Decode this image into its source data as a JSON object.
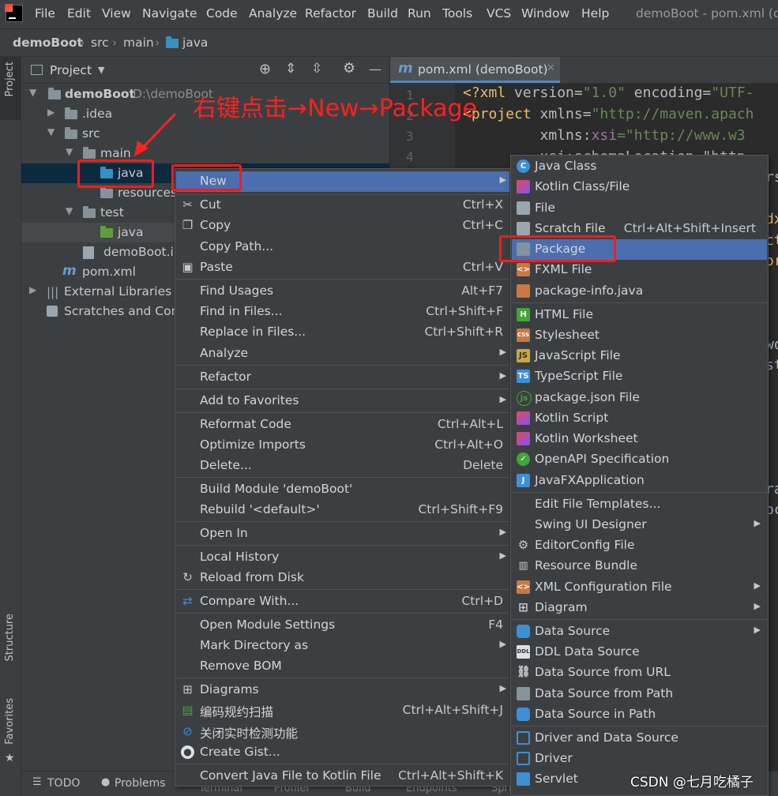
{
  "menubar": {
    "items": [
      "File",
      "Edit",
      "View",
      "Navigate",
      "Code",
      "Analyze",
      "Refactor",
      "Build",
      "Run",
      "Tools",
      "VCS",
      "Window",
      "Help"
    ],
    "window_title": "demoBoot - pom.xml (de"
  },
  "breadcrumb": [
    "demoBoot",
    "src",
    "main",
    "java"
  ],
  "stripe": {
    "project": "Project",
    "structure": "Structure",
    "favorites": "Favorites"
  },
  "project_panel": {
    "title": "Project",
    "tree": [
      {
        "label": "demoBoot",
        "path": "D:\\demoBoot"
      },
      {
        "label": ".idea"
      },
      {
        "label": "src"
      },
      {
        "label": "main"
      },
      {
        "label": "java"
      },
      {
        "label": "resources"
      },
      {
        "label": "test"
      },
      {
        "label": "java"
      },
      {
        "label": "demoBoot.iml"
      },
      {
        "label": "pom.xml"
      },
      {
        "label": "External Libraries"
      },
      {
        "label": "Scratches and Cons"
      }
    ]
  },
  "editor": {
    "tab": "pom.xml (demoBoot)",
    "gutter": [
      "1",
      "2",
      "3",
      "4"
    ],
    "lines": [
      {
        "a": "<?xml ",
        "b": "version=",
        "c": "\"1.0\" ",
        "d": "encoding=",
        "e": "\"UTF-"
      },
      {
        "a": "<project ",
        "b": "xmlns=",
        "c": "\"http://maven.apach"
      },
      {
        "a": "         ",
        "b": "xmlns:",
        "c": "xsi",
        "d": "=\"http://www.w3"
      },
      {
        "a": "         ",
        "b": "xsi:schemaLocation=\"http"
      }
    ],
    "peeks": [
      "rs",
      "dx",
      "ct",
      "or",
      "wo",
      "st",
      "ra",
      "oc"
    ]
  },
  "annotation": "右键点击→New→Package",
  "context_menu": {
    "items": [
      {
        "label": "New",
        "shortcut": "",
        "submenu": true,
        "selected": true
      },
      {
        "label": "Cut",
        "shortcut": "Ctrl+X",
        "icon": "scissors"
      },
      {
        "label": "Copy",
        "shortcut": "Ctrl+C",
        "icon": "copy"
      },
      {
        "label": "Copy Path...",
        "shortcut": ""
      },
      {
        "label": "Paste",
        "shortcut": "Ctrl+V",
        "icon": "clipboard"
      },
      {
        "label": "Find Usages",
        "shortcut": "Alt+F7"
      },
      {
        "label": "Find in Files...",
        "shortcut": "Ctrl+Shift+F"
      },
      {
        "label": "Replace in Files...",
        "shortcut": "Ctrl+Shift+R"
      },
      {
        "label": "Analyze",
        "shortcut": "",
        "submenu": true
      },
      {
        "label": "Refactor",
        "shortcut": "",
        "submenu": true
      },
      {
        "label": "Add to Favorites",
        "shortcut": "",
        "submenu": true
      },
      {
        "label": "Reformat Code",
        "shortcut": "Ctrl+Alt+L"
      },
      {
        "label": "Optimize Imports",
        "shortcut": "Ctrl+Alt+O"
      },
      {
        "label": "Delete...",
        "shortcut": "Delete"
      },
      {
        "label": "Build Module 'demoBoot'",
        "shortcut": ""
      },
      {
        "label": "Rebuild '<default>'",
        "shortcut": "Ctrl+Shift+F9"
      },
      {
        "label": "Open In",
        "shortcut": "",
        "submenu": true
      },
      {
        "label": "Local History",
        "shortcut": "",
        "submenu": true
      },
      {
        "label": "Reload from Disk",
        "shortcut": "",
        "icon": "reload"
      },
      {
        "label": "Compare With...",
        "shortcut": "Ctrl+D",
        "icon": "compare"
      },
      {
        "label": "Open Module Settings",
        "shortcut": "F4"
      },
      {
        "label": "Mark Directory as",
        "shortcut": "",
        "submenu": true
      },
      {
        "label": "Remove BOM",
        "shortcut": ""
      },
      {
        "label": "Diagrams",
        "shortcut": "",
        "submenu": true,
        "icon": "diagram"
      },
      {
        "label": "编码规约扫描",
        "shortcut": "Ctrl+Alt+Shift+J",
        "icon": "scan"
      },
      {
        "label": "关闭实时检测功能",
        "shortcut": "",
        "icon": "block"
      },
      {
        "label": "Create Gist...",
        "shortcut": "",
        "icon": "github"
      },
      {
        "label": "Convert Java File to Kotlin File",
        "shortcut": "Ctrl+Alt+Shift+K"
      }
    ]
  },
  "submenu": {
    "items": [
      {
        "label": "Java Class",
        "shortcut": "",
        "icon": "class"
      },
      {
        "label": "Kotlin Class/File",
        "shortcut": "",
        "icon": "kotlin"
      },
      {
        "label": "File",
        "shortcut": "",
        "icon": "file"
      },
      {
        "label": "Scratch File",
        "shortcut": "Ctrl+Alt+Shift+Insert",
        "icon": "scratch"
      },
      {
        "label": "Package",
        "shortcut": "",
        "icon": "package",
        "selected": true
      },
      {
        "label": "FXML File",
        "shortcut": "",
        "icon": "fxml"
      },
      {
        "label": "package-info.java",
        "shortcut": "",
        "icon": "java-file"
      },
      {
        "label": "HTML File",
        "shortcut": "",
        "icon": "html"
      },
      {
        "label": "Stylesheet",
        "shortcut": "",
        "icon": "css"
      },
      {
        "label": "JavaScript File",
        "shortcut": "",
        "icon": "js"
      },
      {
        "label": "TypeScript File",
        "shortcut": "",
        "icon": "ts"
      },
      {
        "label": "package.json File",
        "shortcut": "",
        "icon": "nodejs"
      },
      {
        "label": "Kotlin Script",
        "shortcut": "",
        "icon": "kotlin"
      },
      {
        "label": "Kotlin Worksheet",
        "shortcut": "",
        "icon": "kotlin"
      },
      {
        "label": "OpenAPI Specification",
        "shortcut": "",
        "icon": "openapi"
      },
      {
        "label": "JavaFXApplication",
        "shortcut": "",
        "icon": "javafx"
      },
      {
        "label": "Edit File Templates...",
        "shortcut": ""
      },
      {
        "label": "Swing UI Designer",
        "shortcut": "",
        "submenu": true
      },
      {
        "label": "EditorConfig File",
        "shortcut": "",
        "icon": "gear"
      },
      {
        "label": "Resource Bundle",
        "shortcut": "",
        "icon": "bundle"
      },
      {
        "label": "XML Configuration File",
        "shortcut": "",
        "submenu": true,
        "icon": "xml"
      },
      {
        "label": "Diagram",
        "shortcut": "",
        "submenu": true,
        "icon": "diagram"
      },
      {
        "label": "Data Source",
        "shortcut": "",
        "submenu": true,
        "icon": "database"
      },
      {
        "label": "DDL Data Source",
        "shortcut": "",
        "icon": "ddl"
      },
      {
        "label": "Data Source from URL",
        "shortcut": "",
        "icon": "url"
      },
      {
        "label": "Data Source from Path",
        "shortcut": "",
        "icon": "folder"
      },
      {
        "label": "Data Source in Path",
        "shortcut": "",
        "icon": "database"
      },
      {
        "label": "Driver and Data Source",
        "shortcut": "",
        "icon": "driver"
      },
      {
        "label": "Driver",
        "shortcut": "",
        "icon": "driver"
      },
      {
        "label": "Servlet",
        "shortcut": "",
        "icon": "servlet"
      }
    ]
  },
  "bottom_bar": {
    "todo": "TODO",
    "problems": "Problems",
    "terminal": "Terminal",
    "profiler": "Profiler",
    "build": "Build",
    "endpoints": "Endpoints",
    "spring": "Spri"
  },
  "watermark": "CSDN @七月吃橘子",
  "colors": {
    "accent": "#4b6eaf",
    "highlight": "#ff1a1a",
    "background": "#3c3f41"
  }
}
